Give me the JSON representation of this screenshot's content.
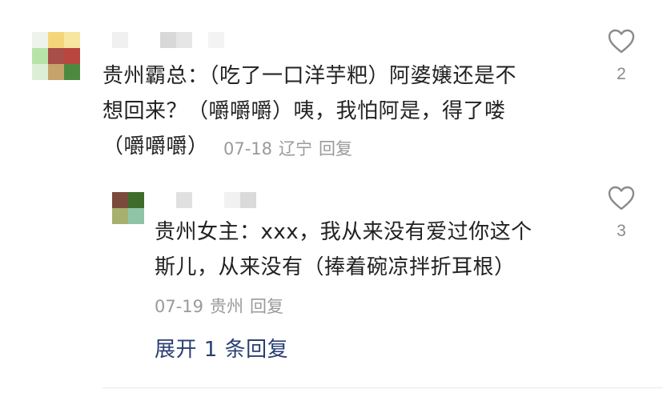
{
  "comments": [
    {
      "text": "贵州霸总：（吃了一口洋芋粑）阿婆嬢还是不\n想回来？（嚼嚼嚼）咦，我怕阿是，得了喽\n（嚼嚼嚼）",
      "date": "07-18",
      "location": "辽宁",
      "reply_label": "回复",
      "likes": "2",
      "replies": [
        {
          "text": "贵州女主：xxx，我从来没有爱过你这个\n斯儿，从来没有（捧着碗凉拌折耳根）",
          "date": "07-19",
          "location": "贵州",
          "reply_label": "回复",
          "likes": "3"
        }
      ],
      "expand_label": "展开 1 条回复"
    }
  ],
  "icons": {
    "like": "heart-outline-icon"
  },
  "colors": {
    "text": "#222222",
    "meta": "#9a9a9a",
    "link": "#2a3f73",
    "like_icon": "#8a8a8a"
  }
}
